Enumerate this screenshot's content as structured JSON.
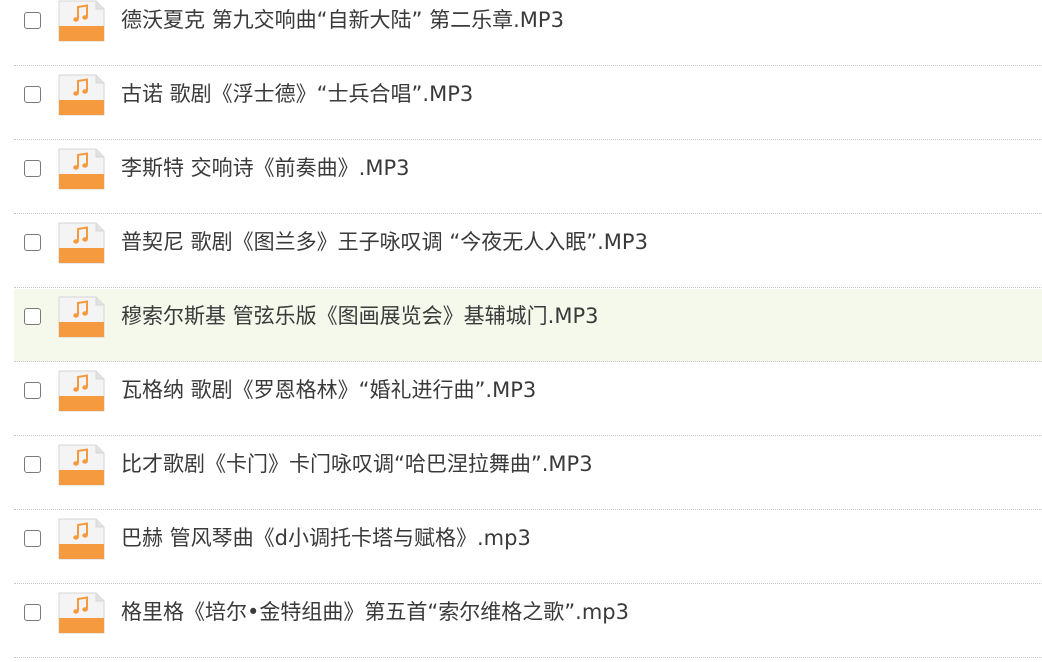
{
  "colors": {
    "icon_orange": "#f59a3e",
    "icon_paper": "#f4f4f4",
    "hover_row_bg": "#f4f9ec"
  },
  "icon_name": "music-file-icon",
  "files": [
    {
      "name": "德沃夏克 第九交响曲“自新大陆” 第二乐章.MP3",
      "checked": false,
      "hover": false
    },
    {
      "name": "古诺 歌剧《浮士德》“士兵合唱”.MP3",
      "checked": false,
      "hover": false
    },
    {
      "name": "李斯特 交响诗《前奏曲》.MP3",
      "checked": false,
      "hover": false
    },
    {
      "name": "普契尼 歌剧《图兰多》王子咏叹调 “今夜无人入眠”.MP3",
      "checked": false,
      "hover": false
    },
    {
      "name": "穆索尔斯基 管弦乐版《图画展览会》基辅城门.MP3",
      "checked": false,
      "hover": true
    },
    {
      "name": "瓦格纳 歌剧《罗恩格林》“婚礼进行曲”.MP3",
      "checked": false,
      "hover": false
    },
    {
      "name": "比才歌剧《卡门》卡门咏叹调“哈巴涅拉舞曲”.MP3",
      "checked": false,
      "hover": false
    },
    {
      "name": "巴赫 管风琴曲《d小调托卡塔与赋格》.mp3",
      "checked": false,
      "hover": false
    },
    {
      "name": "格里格《培尔•金特组曲》第五首“索尔维格之歌”.mp3",
      "checked": false,
      "hover": false
    }
  ]
}
